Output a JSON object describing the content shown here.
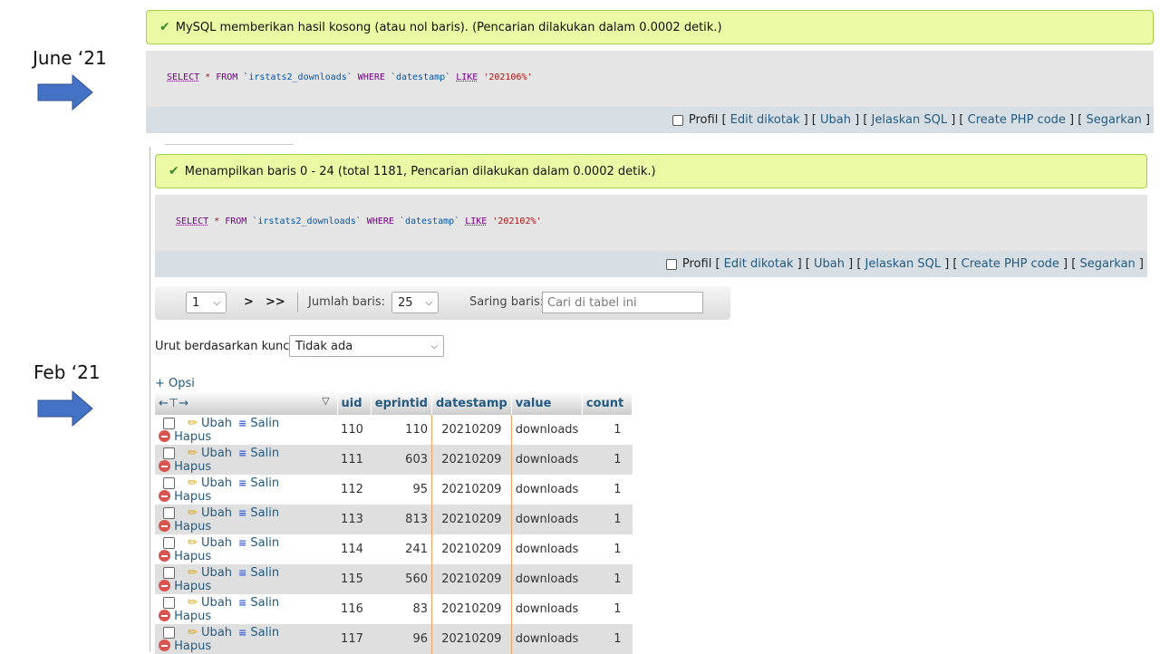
{
  "annotations": {
    "june_label": "June ‘21",
    "feb_label": "Feb ‘21",
    "arrow_color": "#4472c4"
  },
  "query1": {
    "message": "MySQL memberikan hasil kosong (atau nol baris). (Pencarian dilakukan dalam 0.0002 detik.)",
    "sql": {
      "select": "SELECT",
      "star": "*",
      "from": "FROM",
      "table": "`irstats2_downloads`",
      "where": "WHERE",
      "column": "`datestamp`",
      "like": "LIKE",
      "value": "'202106%'"
    }
  },
  "query2": {
    "message": "Menampilkan baris 0 - 24 (total 1181, Pencarian dilakukan dalam 0.0002 detik.)",
    "sql": {
      "select": "SELECT",
      "star": "*",
      "from": "FROM",
      "table": "`irstats2_downloads`",
      "where": "WHERE",
      "column": "`datestamp`",
      "like": "LIKE",
      "value": "'202102%'"
    }
  },
  "toolbar": {
    "profil": "Profil",
    "edit_inline": "Edit dikotak",
    "edit": "Ubah",
    "explain": "Jelaskan SQL",
    "php": "Create PHP code",
    "refresh": "Segarkan"
  },
  "nav": {
    "page": "1",
    "next": ">",
    "last": ">>",
    "rows_label": "Jumlah baris:",
    "rows_value": "25",
    "filter_label": "Saring baris:",
    "filter_placeholder": "Cari di tabel ini"
  },
  "sort": {
    "label": "Urut berdasarkan kunci:",
    "value": "Tidak ada"
  },
  "options_link": "+ Opsi",
  "columns": [
    "uid",
    "eprintid",
    "datestamp",
    "value",
    "count"
  ],
  "row_actions": {
    "edit": "Ubah",
    "copy": "Salin",
    "delete": "Hapus"
  },
  "rows": [
    {
      "uid": "110",
      "eprintid": "110",
      "datestamp": "20210209",
      "value": "downloads",
      "count": "1"
    },
    {
      "uid": "111",
      "eprintid": "603",
      "datestamp": "20210209",
      "value": "downloads",
      "count": "1"
    },
    {
      "uid": "112",
      "eprintid": "95",
      "datestamp": "20210209",
      "value": "downloads",
      "count": "1"
    },
    {
      "uid": "113",
      "eprintid": "813",
      "datestamp": "20210209",
      "value": "downloads",
      "count": "1"
    },
    {
      "uid": "114",
      "eprintid": "241",
      "datestamp": "20210209",
      "value": "downloads",
      "count": "1"
    },
    {
      "uid": "115",
      "eprintid": "560",
      "datestamp": "20210209",
      "value": "downloads",
      "count": "1"
    },
    {
      "uid": "116",
      "eprintid": "83",
      "datestamp": "20210209",
      "value": "downloads",
      "count": "1"
    },
    {
      "uid": "117",
      "eprintid": "96",
      "datestamp": "20210209",
      "value": "downloads",
      "count": "1"
    }
  ]
}
